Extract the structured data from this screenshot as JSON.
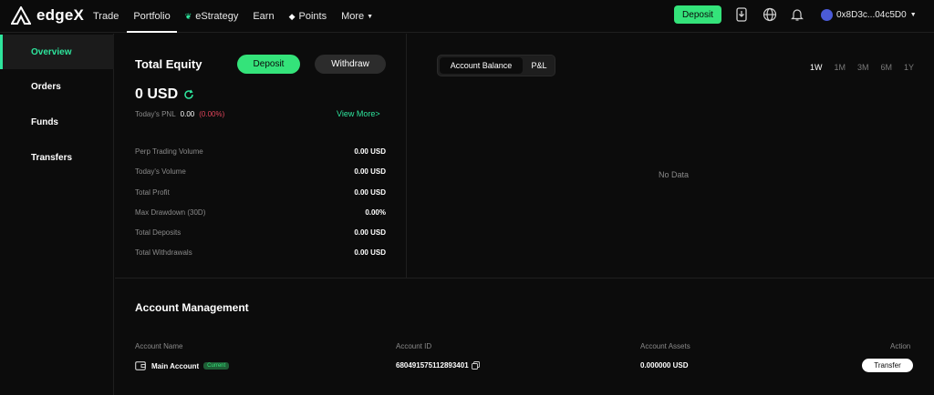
{
  "brand": {
    "name": "edgeX",
    "icon": "edgex-logo-icon"
  },
  "nav": {
    "items": [
      {
        "label": "Trade"
      },
      {
        "label": "Portfolio",
        "active": true
      },
      {
        "label": "eStrategy",
        "icon": "leaf-icon"
      },
      {
        "label": "Earn"
      },
      {
        "label": "Points",
        "icon": "diamond-icon"
      },
      {
        "label": "More",
        "icon": "chevron-down-icon"
      }
    ],
    "deposit_label": "Deposit",
    "account_label": "0x8D3c...04c5D0",
    "icons": [
      "download-app-icon",
      "globe-icon",
      "notification-bell-icon"
    ]
  },
  "sidebar": {
    "items": [
      {
        "label": "Overview",
        "active": true
      },
      {
        "label": "Orders"
      },
      {
        "label": "Funds"
      },
      {
        "label": "Transfers"
      }
    ]
  },
  "equity": {
    "title": "Total Equity",
    "deposit_label": "Deposit",
    "withdraw_label": "Withdraw",
    "value": "0 USD",
    "pnl_label": "Today's PNL",
    "pnl_value": "0.00",
    "pnl_pct": "(0.00%)",
    "view_more": "View More>",
    "stats": [
      {
        "label": "Perp Trading Volume",
        "value": "0.00 USD"
      },
      {
        "label": "Today's Volume",
        "value": "0.00 USD"
      },
      {
        "label": "Total Profit",
        "value": "0.00 USD"
      },
      {
        "label": "Max Drawdown (30D)",
        "value": "0.00%"
      },
      {
        "label": "Total Deposits",
        "value": "0.00 USD"
      },
      {
        "label": "Total Withdrawals",
        "value": "0.00 USD"
      }
    ]
  },
  "chart_panel": {
    "tabs": [
      {
        "label": "Account Balance",
        "active": true
      },
      {
        "label": "P&L"
      }
    ],
    "ranges": [
      {
        "label": "1W",
        "active": true
      },
      {
        "label": "1M"
      },
      {
        "label": "3M"
      },
      {
        "label": "6M"
      },
      {
        "label": "1Y"
      }
    ],
    "empty_text": "No Data"
  },
  "account_management": {
    "title": "Account Management",
    "columns": [
      "Account Name",
      "Account ID",
      "Account Assets",
      "Action"
    ],
    "rows": [
      {
        "name": "Main Account",
        "badge": "Current",
        "id": "680491575112893401",
        "assets": "0.000000 USD",
        "action": "Transfer"
      }
    ]
  },
  "colors": {
    "accent": "#34e37a",
    "negative": "#e0445a",
    "background": "#0c0c0c"
  }
}
